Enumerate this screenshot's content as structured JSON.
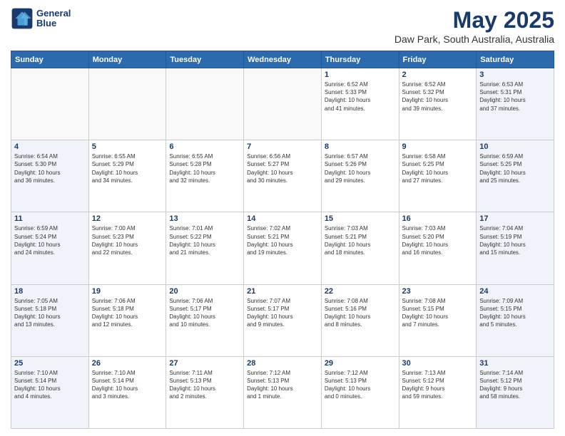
{
  "header": {
    "logo_line1": "General",
    "logo_line2": "Blue",
    "title": "May 2025",
    "subtitle": "Daw Park, South Australia, Australia"
  },
  "days_of_week": [
    "Sunday",
    "Monday",
    "Tuesday",
    "Wednesday",
    "Thursday",
    "Friday",
    "Saturday"
  ],
  "weeks": [
    [
      {
        "day": "",
        "info": "",
        "empty": true
      },
      {
        "day": "",
        "info": "",
        "empty": true
      },
      {
        "day": "",
        "info": "",
        "empty": true
      },
      {
        "day": "",
        "info": "",
        "empty": true
      },
      {
        "day": "1",
        "info": "Sunrise: 6:52 AM\nSunset: 5:33 PM\nDaylight: 10 hours\nand 41 minutes."
      },
      {
        "day": "2",
        "info": "Sunrise: 6:52 AM\nSunset: 5:32 PM\nDaylight: 10 hours\nand 39 minutes."
      },
      {
        "day": "3",
        "info": "Sunrise: 6:53 AM\nSunset: 5:31 PM\nDaylight: 10 hours\nand 37 minutes.",
        "shade": true
      }
    ],
    [
      {
        "day": "4",
        "info": "Sunrise: 6:54 AM\nSunset: 5:30 PM\nDaylight: 10 hours\nand 36 minutes.",
        "shade": true
      },
      {
        "day": "5",
        "info": "Sunrise: 6:55 AM\nSunset: 5:29 PM\nDaylight: 10 hours\nand 34 minutes."
      },
      {
        "day": "6",
        "info": "Sunrise: 6:55 AM\nSunset: 5:28 PM\nDaylight: 10 hours\nand 32 minutes."
      },
      {
        "day": "7",
        "info": "Sunrise: 6:56 AM\nSunset: 5:27 PM\nDaylight: 10 hours\nand 30 minutes."
      },
      {
        "day": "8",
        "info": "Sunrise: 6:57 AM\nSunset: 5:26 PM\nDaylight: 10 hours\nand 29 minutes."
      },
      {
        "day": "9",
        "info": "Sunrise: 6:58 AM\nSunset: 5:25 PM\nDaylight: 10 hours\nand 27 minutes."
      },
      {
        "day": "10",
        "info": "Sunrise: 6:59 AM\nSunset: 5:25 PM\nDaylight: 10 hours\nand 25 minutes.",
        "shade": true
      }
    ],
    [
      {
        "day": "11",
        "info": "Sunrise: 6:59 AM\nSunset: 5:24 PM\nDaylight: 10 hours\nand 24 minutes.",
        "shade": true
      },
      {
        "day": "12",
        "info": "Sunrise: 7:00 AM\nSunset: 5:23 PM\nDaylight: 10 hours\nand 22 minutes."
      },
      {
        "day": "13",
        "info": "Sunrise: 7:01 AM\nSunset: 5:22 PM\nDaylight: 10 hours\nand 21 minutes."
      },
      {
        "day": "14",
        "info": "Sunrise: 7:02 AM\nSunset: 5:21 PM\nDaylight: 10 hours\nand 19 minutes."
      },
      {
        "day": "15",
        "info": "Sunrise: 7:03 AM\nSunset: 5:21 PM\nDaylight: 10 hours\nand 18 minutes."
      },
      {
        "day": "16",
        "info": "Sunrise: 7:03 AM\nSunset: 5:20 PM\nDaylight: 10 hours\nand 16 minutes."
      },
      {
        "day": "17",
        "info": "Sunrise: 7:04 AM\nSunset: 5:19 PM\nDaylight: 10 hours\nand 15 minutes.",
        "shade": true
      }
    ],
    [
      {
        "day": "18",
        "info": "Sunrise: 7:05 AM\nSunset: 5:18 PM\nDaylight: 10 hours\nand 13 minutes.",
        "shade": true
      },
      {
        "day": "19",
        "info": "Sunrise: 7:06 AM\nSunset: 5:18 PM\nDaylight: 10 hours\nand 12 minutes."
      },
      {
        "day": "20",
        "info": "Sunrise: 7:06 AM\nSunset: 5:17 PM\nDaylight: 10 hours\nand 10 minutes."
      },
      {
        "day": "21",
        "info": "Sunrise: 7:07 AM\nSunset: 5:17 PM\nDaylight: 10 hours\nand 9 minutes."
      },
      {
        "day": "22",
        "info": "Sunrise: 7:08 AM\nSunset: 5:16 PM\nDaylight: 10 hours\nand 8 minutes."
      },
      {
        "day": "23",
        "info": "Sunrise: 7:08 AM\nSunset: 5:15 PM\nDaylight: 10 hours\nand 7 minutes."
      },
      {
        "day": "24",
        "info": "Sunrise: 7:09 AM\nSunset: 5:15 PM\nDaylight: 10 hours\nand 5 minutes.",
        "shade": true
      }
    ],
    [
      {
        "day": "25",
        "info": "Sunrise: 7:10 AM\nSunset: 5:14 PM\nDaylight: 10 hours\nand 4 minutes.",
        "shade": true
      },
      {
        "day": "26",
        "info": "Sunrise: 7:10 AM\nSunset: 5:14 PM\nDaylight: 10 hours\nand 3 minutes."
      },
      {
        "day": "27",
        "info": "Sunrise: 7:11 AM\nSunset: 5:13 PM\nDaylight: 10 hours\nand 2 minutes."
      },
      {
        "day": "28",
        "info": "Sunrise: 7:12 AM\nSunset: 5:13 PM\nDaylight: 10 hours\nand 1 minute."
      },
      {
        "day": "29",
        "info": "Sunrise: 7:12 AM\nSunset: 5:13 PM\nDaylight: 10 hours\nand 0 minutes."
      },
      {
        "day": "30",
        "info": "Sunrise: 7:13 AM\nSunset: 5:12 PM\nDaylight: 9 hours\nand 59 minutes."
      },
      {
        "day": "31",
        "info": "Sunrise: 7:14 AM\nSunset: 5:12 PM\nDaylight: 9 hours\nand 58 minutes.",
        "shade": true
      }
    ]
  ]
}
